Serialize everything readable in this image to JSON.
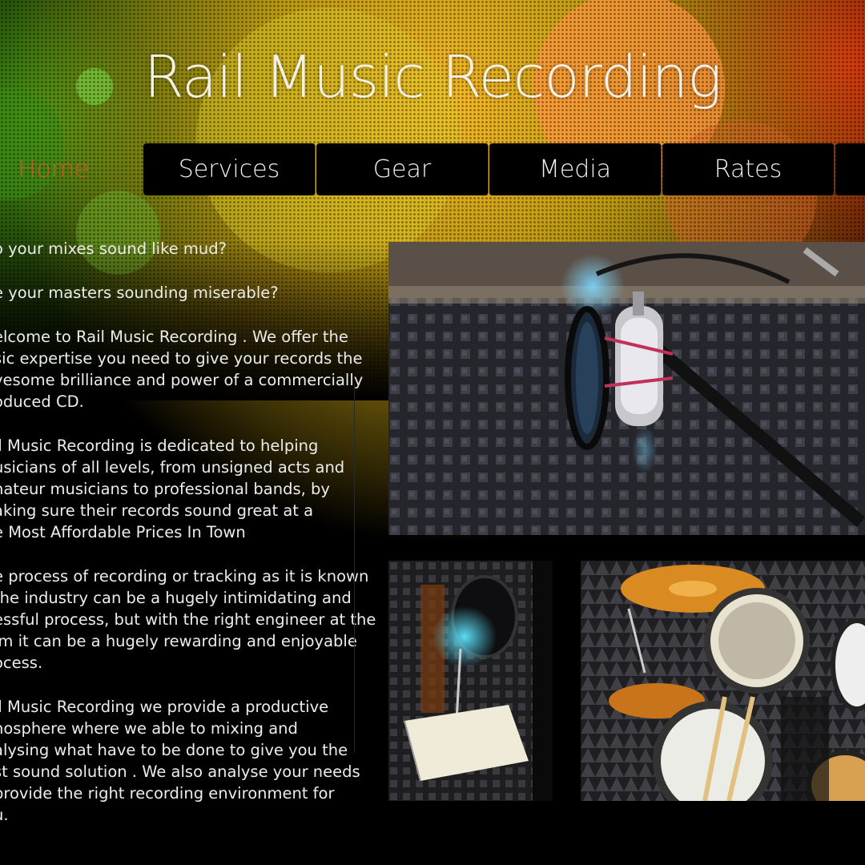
{
  "site": {
    "title": "Rail Music Recording"
  },
  "nav": {
    "items": [
      {
        "label": "Home",
        "active": true
      },
      {
        "label": "Services",
        "active": false
      },
      {
        "label": "Gear",
        "active": false
      },
      {
        "label": "Media",
        "active": false
      },
      {
        "label": "Rates",
        "active": false
      }
    ]
  },
  "content": {
    "paragraphs": [
      [
        "o your mixes sound like mud?"
      ],
      [
        "e your masters sounding miserable?"
      ],
      [
        "elcome to Rail Music Recording . We offer the",
        "sic expertise you need to give your records the",
        "vesome brilliance and power of a commercially",
        "oduced CD."
      ],
      [
        "il Music Recording is dedicated to helping",
        "usicians of all levels, from unsigned acts and",
        "nateur musicians to professional bands, by",
        "aking sure their records sound great at a",
        "e Most Affordable Prices In Town"
      ],
      [
        "e process of recording or tracking as it is known",
        "the industry can be a hugely intimidating and",
        "essful process, but with the right engineer at the",
        "lm it can be a hugely rewarding and enjoyable",
        "ocess."
      ],
      [
        "il Music Recording we provide a productive",
        "nosphere where we able to mixing and",
        "alysing what have to be done to give you the",
        "st sound solution . We also analyse your needs",
        " provide the right recording environment for",
        "u."
      ]
    ]
  },
  "images": {
    "main": "studio-microphone-photo",
    "bottom_left": "vocal-booth-photo",
    "bottom_right": "drum-kit-photo"
  },
  "colors": {
    "active_nav": "#c85a2e",
    "nav_bg": "#000000",
    "text": "#ececec"
  }
}
